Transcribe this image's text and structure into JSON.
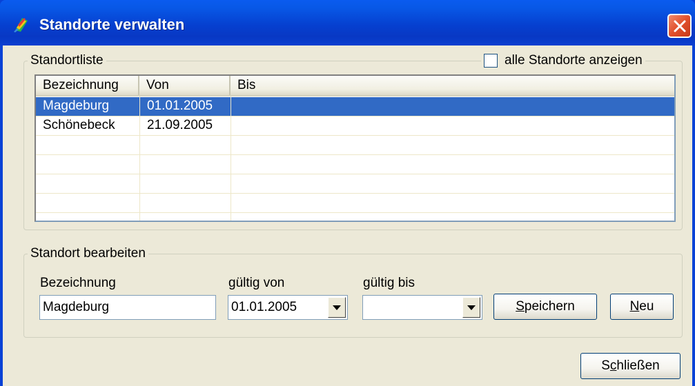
{
  "window": {
    "title": "Standorte verwalten",
    "close_icon": "close-icon",
    "app_icon": "app-icon"
  },
  "list_group": {
    "legend": "Standortliste",
    "show_all_label": "alle Standorte anzeigen",
    "show_all_checked": false,
    "columns": [
      "Bezeichnung",
      "Von",
      "Bis"
    ],
    "rows": [
      {
        "bezeichnung": "Magdeburg",
        "von": "01.01.2005",
        "bis": "",
        "selected": true
      },
      {
        "bezeichnung": "Schönebeck",
        "von": "21.09.2005",
        "bis": "",
        "selected": false
      }
    ]
  },
  "edit_group": {
    "legend": "Standort bearbeiten",
    "name_label": "Bezeichnung",
    "name_value": "Magdeburg",
    "valid_from_label": "gültig von",
    "valid_from_value": "01.01.2005",
    "valid_to_label": "gültig bis",
    "valid_to_value": "",
    "save_label_mnemonic": "S",
    "save_label_rest": "peichern",
    "new_label_mnemonic": "N",
    "new_label_rest": "eu"
  },
  "footer": {
    "close_label_pre": "S",
    "close_label_mnemonic": "c",
    "close_label_rest": "hließen"
  },
  "colors": {
    "titlebar": "#0842d6",
    "selection": "#316ac5",
    "dialog_bg": "#ece9d8",
    "close_button": "#e1502c"
  }
}
